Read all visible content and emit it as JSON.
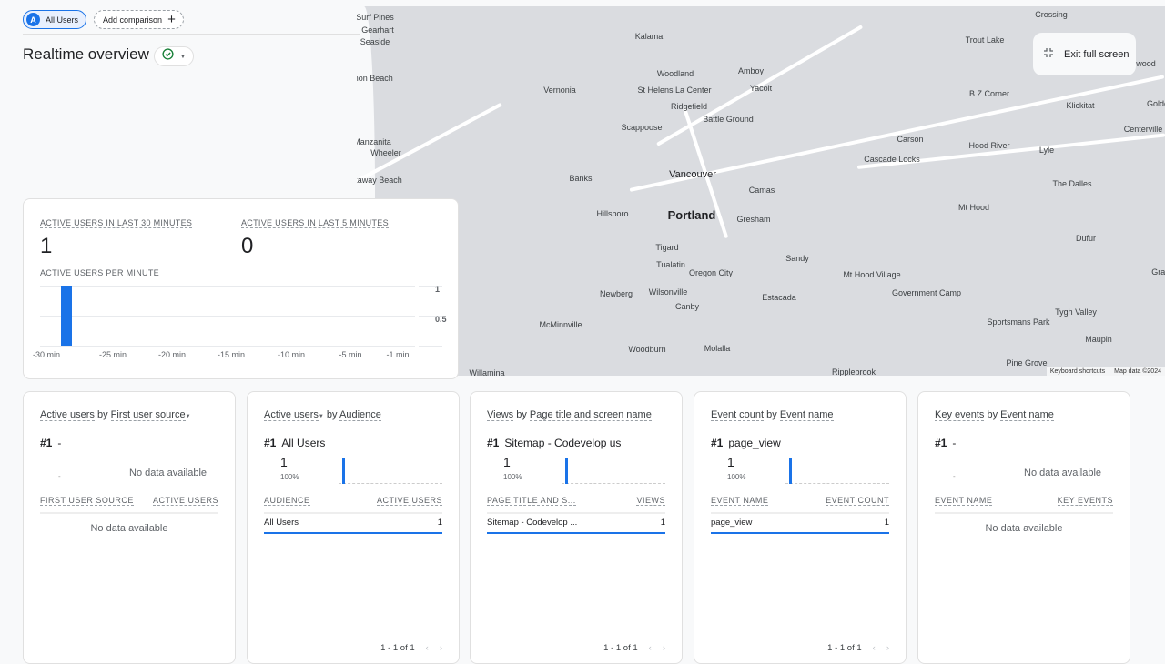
{
  "topbar": {
    "audience_chip": "All Users",
    "audience_avatar": "A",
    "add_comparison": "Add comparison"
  },
  "page": {
    "title": "Realtime overview"
  },
  "map": {
    "exit_fullscreen": "Exit full screen",
    "keyboard_shortcuts": "Keyboard shortcuts",
    "map_data": "Map data ©2024",
    "places": [
      "Surf Pines",
      "Gearhart",
      "Seaside",
      "Cannon Beach",
      "Manzanita",
      "Wheeler",
      "Rockaway Beach",
      "Kalama",
      "Woodland",
      "Amboy",
      "Vernonia",
      "St Helens La Center",
      "Yacolt",
      "Ridgefield",
      "Battle Ground",
      "Scappoose",
      "Vancouver",
      "Banks",
      "Camas",
      "Hillsboro",
      "Portland",
      "Gresham",
      "Tigard",
      "Tualatin",
      "Oregon City",
      "Sandy",
      "Newberg",
      "Wilsonville",
      "Estacada",
      "Canby",
      "McMinnville",
      "Woodburn",
      "Molalla",
      "Willamina",
      "Ripplebrook",
      "Trout Lake",
      "Crossing",
      "B Z Corner",
      "Klickitat",
      "Golde",
      "Centerville",
      "Carson",
      "Hood River",
      "Lyle",
      "Cascade Locks",
      "The Dalles",
      "Mt Hood",
      "Dufur",
      "Mt Hood Village",
      "Government Camp",
      "Gras",
      "Sportsmans Park",
      "Tygh Valley",
      "Maupin",
      "Pine Grove",
      "wood"
    ]
  },
  "summary": {
    "label_30": "Active users in last 30 minutes",
    "value_30": "1",
    "label_5": "Active users in last 5 minutes",
    "value_5": "0",
    "label_per_minute": "Active users per minute"
  },
  "chart_data": {
    "type": "bar",
    "x_ticks": [
      "-30 min",
      "-25 min",
      "-20 min",
      "-15 min",
      "-10 min",
      "-5 min",
      "-1 min"
    ],
    "y_ticks": [
      "1",
      "0.5"
    ],
    "ylim": [
      0,
      1
    ],
    "values": [
      0,
      1,
      0,
      0,
      0,
      0,
      0,
      0,
      0,
      0,
      0,
      0,
      0,
      0,
      0,
      0,
      0,
      0,
      0,
      0,
      0,
      0,
      0,
      0,
      0,
      0,
      0,
      0,
      0,
      0
    ],
    "color": "#1a73e8"
  },
  "cards": [
    {
      "title_a": "Active users",
      "title_mid": " by ",
      "title_b": "First user source",
      "dropdown_after_b": true,
      "rank": "#1",
      "rank_name": "-",
      "no_data_top": "No data available",
      "col1": "First user source",
      "col2": "Active users",
      "no_data": "No data available"
    },
    {
      "title_a": "Active users",
      "title_mid": " by ",
      "title_b": "Audience",
      "dropdown_after_a": true,
      "rank": "#1",
      "rank_name": "All Users",
      "value": "1",
      "pct": "100%",
      "col1": "Audience",
      "col2": "Active users",
      "row": [
        "All Users",
        "1"
      ],
      "pager": "1 - 1 of 1"
    },
    {
      "title_a": "Views",
      "title_mid": " by ",
      "title_b": "Page title and screen name",
      "rank": "#1",
      "rank_name": "Sitemap - Codevelop us",
      "value": "1",
      "pct": "100%",
      "col1": "Page title and s...",
      "col2": "Views",
      "row": [
        "Sitemap - Codevelop ...",
        "1"
      ],
      "pager": "1 - 1 of 1"
    },
    {
      "title_a": "Event count",
      "title_mid": " by ",
      "title_b": "Event name",
      "rank": "#1",
      "rank_name": "page_view",
      "value": "1",
      "pct": "100%",
      "col1": "Event name",
      "col2": "Event count",
      "row": [
        "page_view",
        "1"
      ],
      "pager": "1 - 1 of 1"
    },
    {
      "title_a": "Key events",
      "title_mid": " by ",
      "title_b": "Event name",
      "rank": "#1",
      "rank_name": "-",
      "no_data_top": "No data available",
      "col1": "Event name",
      "col2": "Key events",
      "no_data": "No data available"
    }
  ]
}
